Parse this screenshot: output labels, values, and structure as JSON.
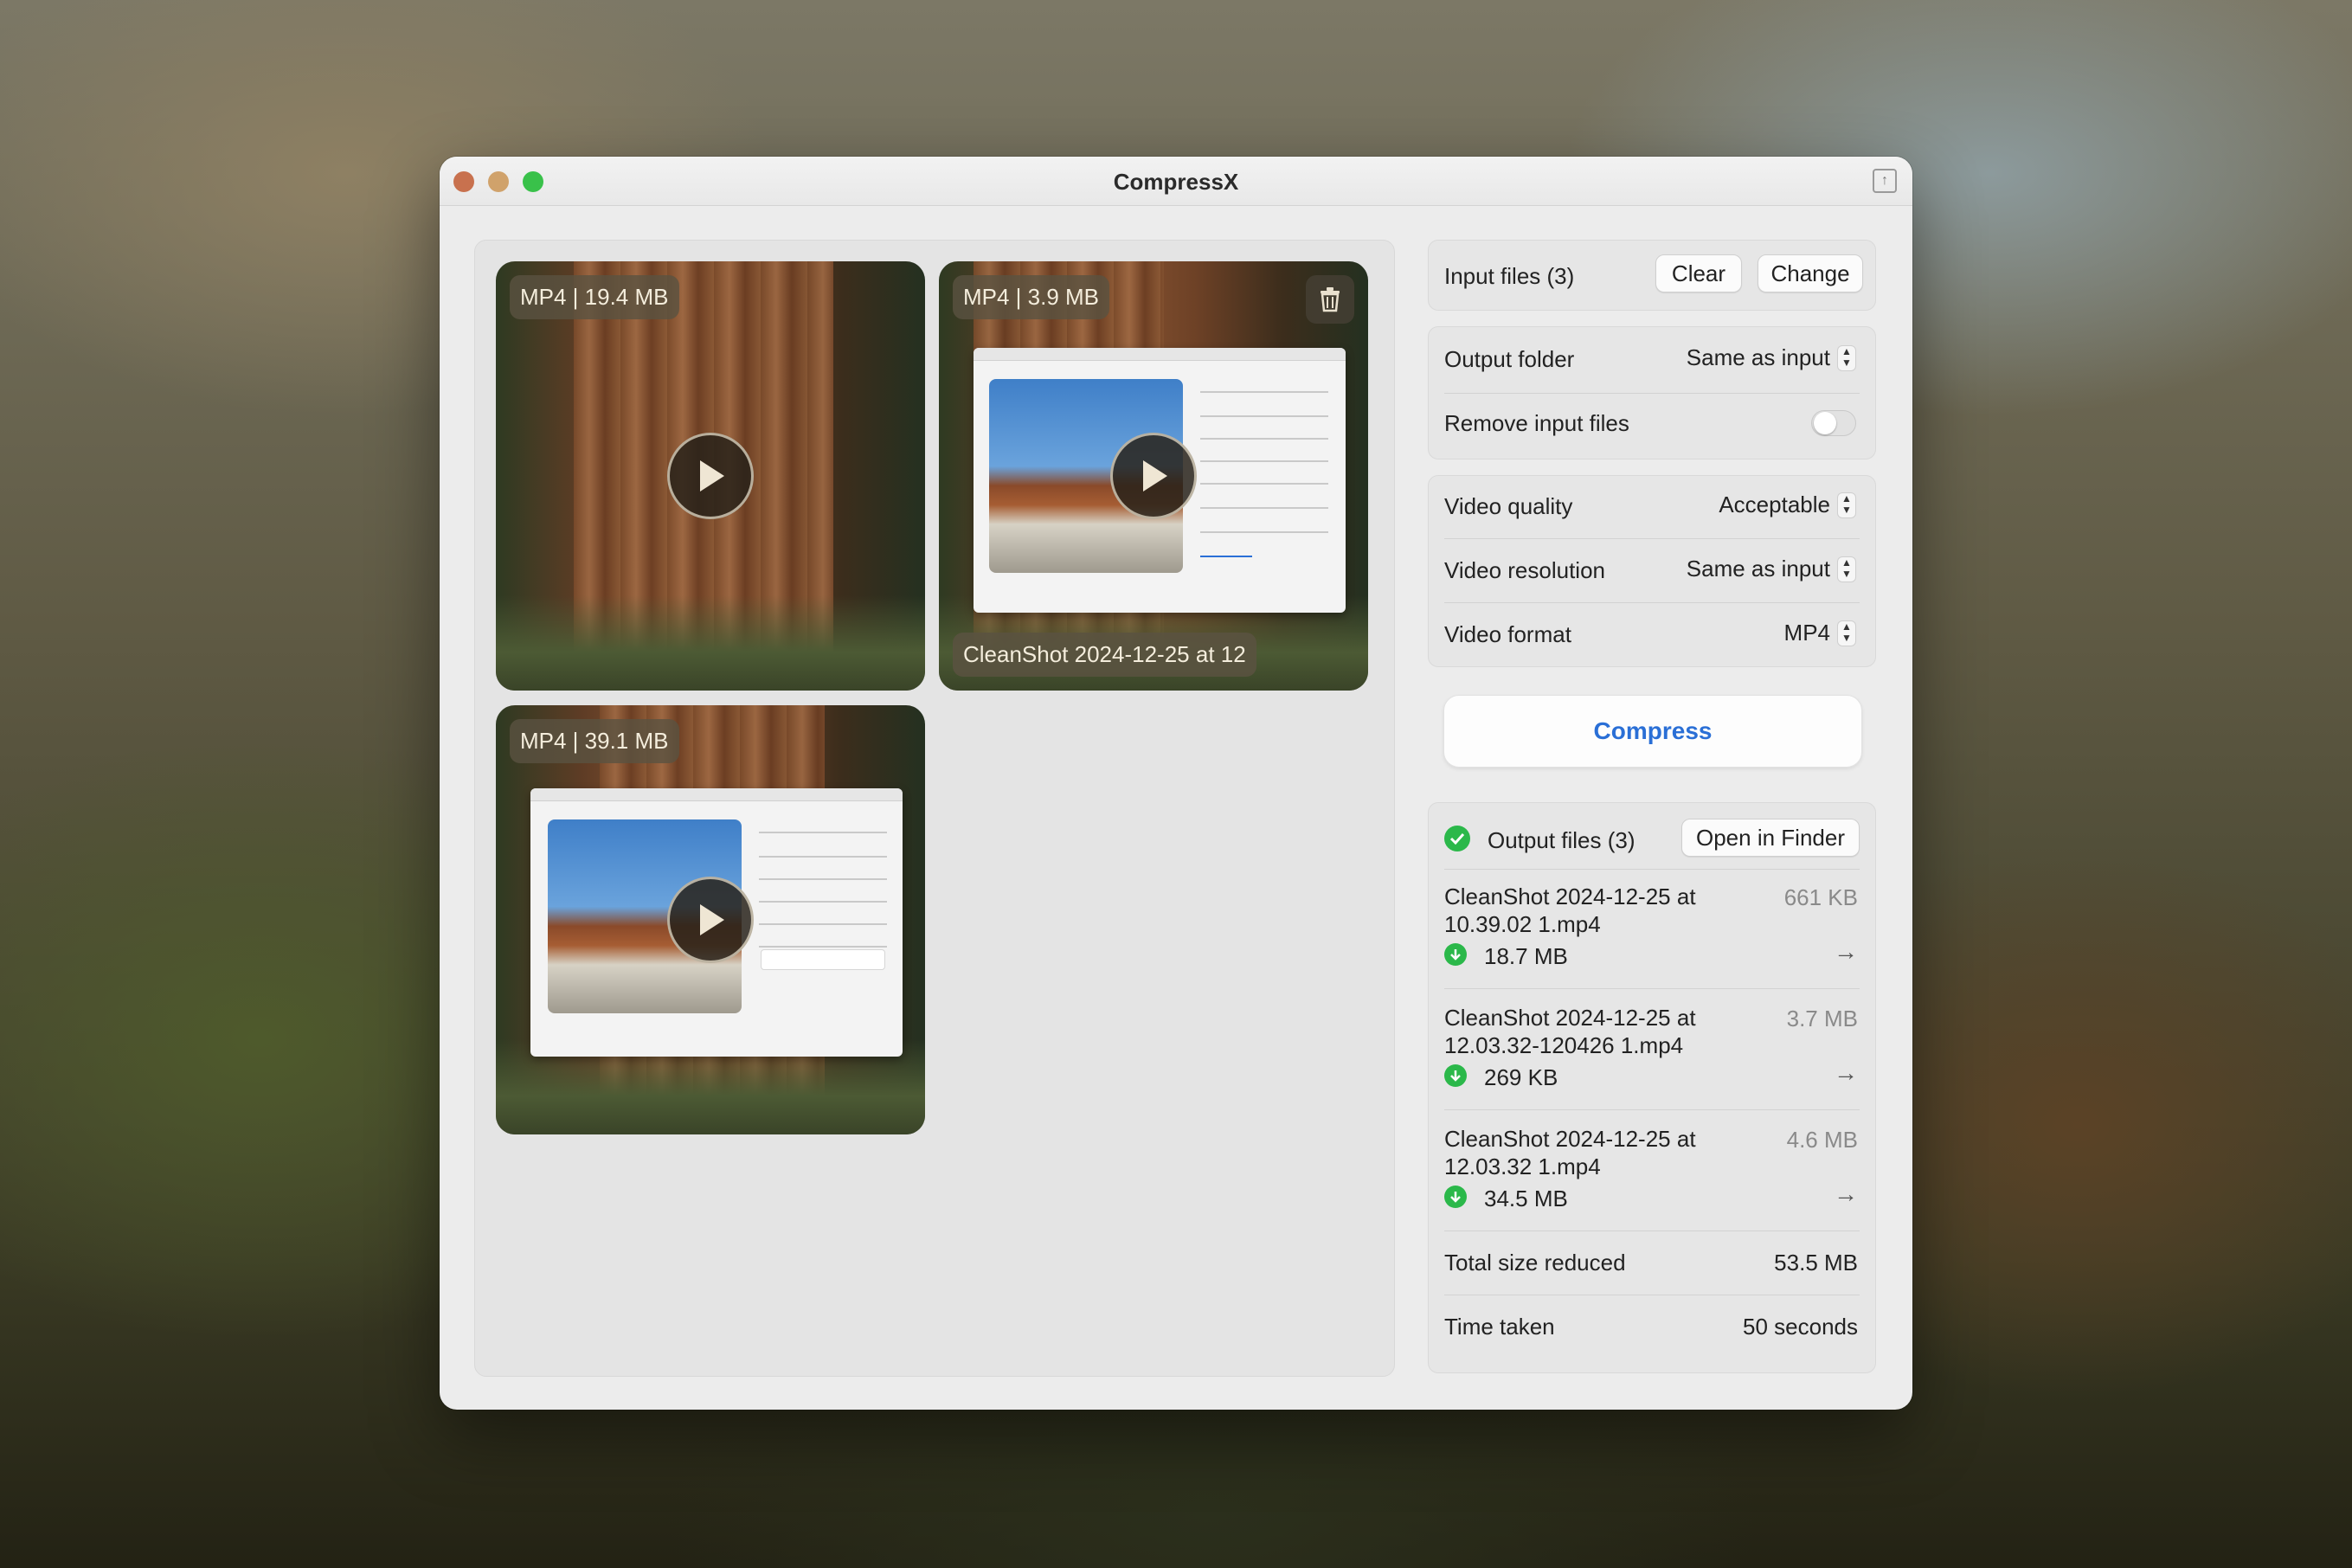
{
  "window": {
    "title": "CompressX"
  },
  "thumbnails": [
    {
      "badge": "MP4 | 19.4 MB",
      "play_icon": "play-icon"
    },
    {
      "badge": "MP4 | 3.9 MB",
      "caption": "CleanShot 2024-12-25 at 12",
      "play_icon": "play-icon",
      "delete_icon": "trash-icon"
    },
    {
      "badge": "MP4 | 39.1 MB",
      "play_icon": "play-icon"
    }
  ],
  "input": {
    "label": "Input files (3)",
    "clear": "Clear",
    "change": "Change"
  },
  "settings": {
    "output_folder": {
      "label": "Output folder",
      "value": "Same as input"
    },
    "remove_input": {
      "label": "Remove input files",
      "on": false
    },
    "video_quality": {
      "label": "Video quality",
      "value": "Acceptable"
    },
    "video_resolution": {
      "label": "Video resolution",
      "value": "Same as input"
    },
    "video_format": {
      "label": "Video format",
      "value": "MP4"
    }
  },
  "compress_label": "Compress",
  "output": {
    "label": "Output files (3)",
    "open_in_finder": "Open in Finder",
    "files": [
      {
        "name": "CleanShot 2024-12-25 at 10.39.02 1.mp4",
        "original": "661 KB",
        "compressed": "18.7 MB"
      },
      {
        "name": "CleanShot 2024-12-25 at 12.03.32-120426 1.mp4",
        "original": "3.7 MB",
        "compressed": "269 KB"
      },
      {
        "name": "CleanShot 2024-12-25 at 12.03.32 1.mp4",
        "original": "4.6 MB",
        "compressed": "34.5 MB"
      }
    ],
    "total_label": "Total size reduced",
    "total_value": "53.5 MB",
    "time_label": "Time taken",
    "time_value": "50 seconds"
  },
  "colors": {
    "accent": "#2a6fd6",
    "success": "#2bb84a"
  }
}
